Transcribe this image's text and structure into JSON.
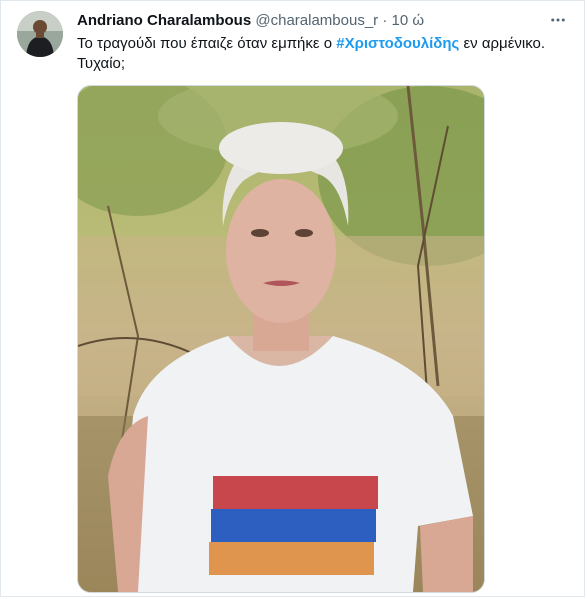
{
  "tweet": {
    "author_name": "Andriano Charalambous",
    "handle": "@charalambous_r",
    "separator": "·",
    "time": "10 ώ",
    "text_before": "Το τραγούδι που έπαιζε όταν εμπήκε ο ",
    "hashtag": "#Χριστοδουλίδης",
    "text_after": " εν αρμένικο. Τυχαίο;"
  },
  "icons": {
    "more": "more-horizontal-icon"
  },
  "colors": {
    "accent": "#1d9bf0",
    "text": "#0f1419",
    "secondary": "#536471",
    "flag_red": "#d90012",
    "flag_blue": "#0033a0",
    "flag_orange": "#f2a800"
  }
}
